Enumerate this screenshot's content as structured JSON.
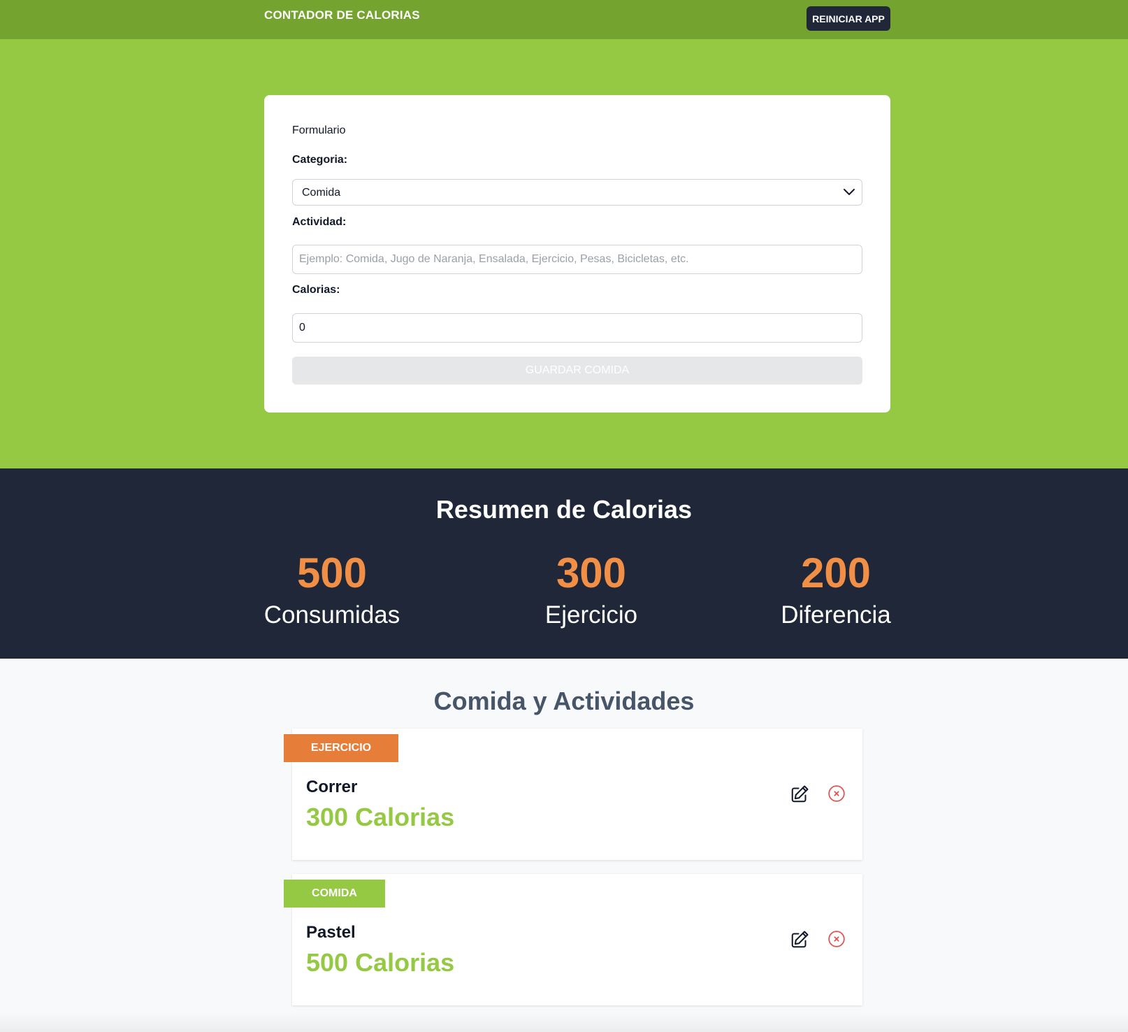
{
  "header": {
    "app_title": "CONTADOR DE CALORIAS",
    "reset_label": "REINICIAR APP"
  },
  "form": {
    "heading": "Formulario",
    "category_label": "Categoria:",
    "category_value": "Comida",
    "activity_label": "Actividad:",
    "activity_value": "",
    "activity_placeholder": "Ejemplo: Comida, Jugo de Naranja, Ensalada, Ejercicio, Pesas, Bicicletas, etc.",
    "calories_label": "Calorias:",
    "calories_value": "0",
    "save_label": "GUARDAR COMIDA",
    "save_enabled": false
  },
  "summary": {
    "title": "Resumen de Calorias",
    "stats": [
      {
        "value": "500",
        "label": "Consumidas"
      },
      {
        "value": "300",
        "label": "Ejercicio"
      },
      {
        "value": "200",
        "label": "Diferencia"
      }
    ]
  },
  "list": {
    "title": "Comida y Actividades",
    "items": [
      {
        "category": "EJERCICIO",
        "name": "Correr",
        "calories": "300 Calorias"
      },
      {
        "category": "COMIDA",
        "name": "Pastel",
        "calories": "500 Calorias"
      }
    ]
  },
  "colors": {
    "header_bg": "#74a330",
    "hero_bg": "#95c944",
    "summary_bg": "#1f2738",
    "stat_accent": "#f08f45",
    "tag_exercise": "#e67e3a",
    "tag_food": "#95c944",
    "calories_text": "#95c944",
    "delete_red": "#e05252"
  },
  "icons": {
    "select": "chevron-down-icon",
    "edit": "pencil-square-icon",
    "delete": "x-circle-icon"
  }
}
